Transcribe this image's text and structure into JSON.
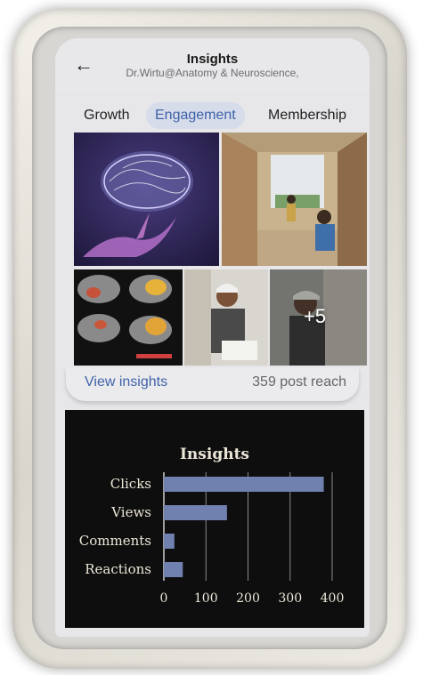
{
  "header": {
    "title": "Insights",
    "subtitle": "Dr.Wirtu@Anatomy & Neuroscience,"
  },
  "tabs": [
    {
      "label": "Growth",
      "active": false
    },
    {
      "label": "Engagement",
      "active": true
    },
    {
      "label": "Membership",
      "active": false
    }
  ],
  "photos": {
    "more_count": "+5"
  },
  "card_footer": {
    "view_insights": "View insights",
    "post_reach": "359 post reach"
  },
  "colors": {
    "accent": "#3f63a8",
    "bar": "#7081b0",
    "chart_bg": "#0e0e0e"
  },
  "chart_data": {
    "type": "bar",
    "orientation": "horizontal",
    "title": "Insights",
    "categories": [
      "Clicks",
      "Views",
      "Comments",
      "Reactions"
    ],
    "values": [
      380,
      150,
      25,
      45
    ],
    "xlim": [
      0,
      400
    ],
    "xticks": [
      0,
      100,
      200,
      300,
      400
    ],
    "grid": true
  }
}
